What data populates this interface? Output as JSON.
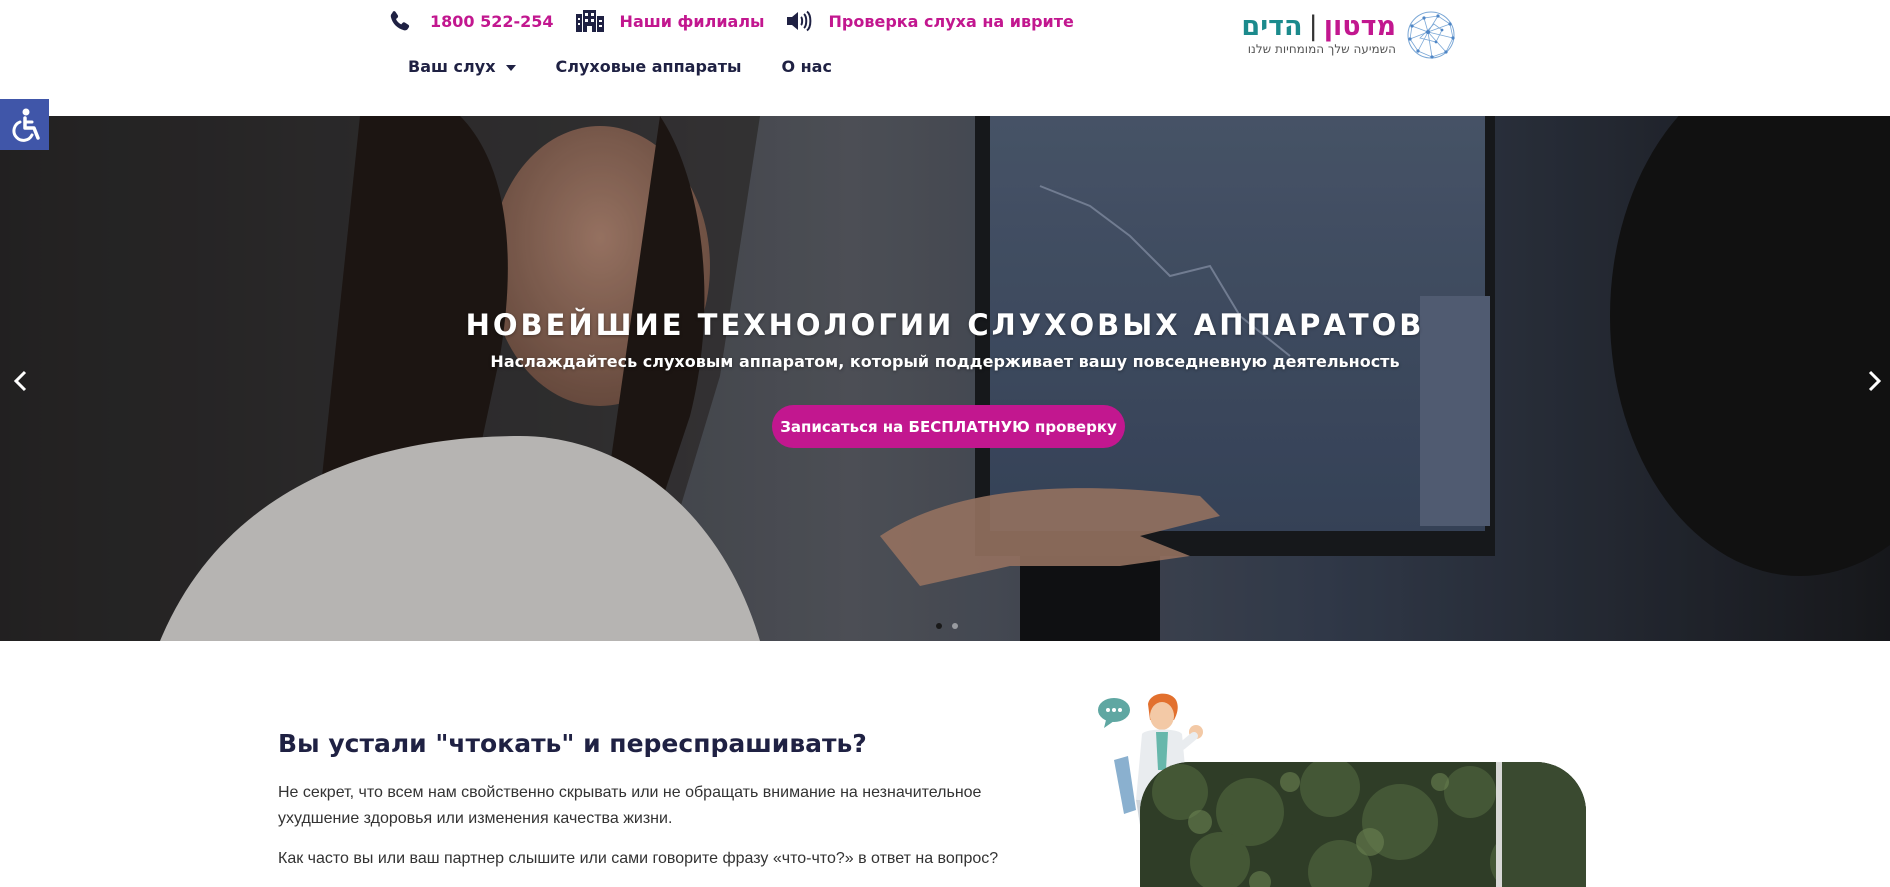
{
  "header": {
    "contacts": [
      {
        "icon": "phone-icon",
        "label": "1800 522-254"
      },
      {
        "icon": "building-icon",
        "label": "Наши филиалы"
      },
      {
        "icon": "speaker-icon",
        "label": "Проверка слуха на иврите"
      }
    ],
    "nav": [
      {
        "label": "Ваш слух",
        "has_dropdown": true
      },
      {
        "label": "Слуховые аппараты"
      },
      {
        "label": "О нас"
      }
    ],
    "logo": {
      "name_part1": "מדטון",
      "separator": "|",
      "name_part2": "הדים",
      "tagline": "השמיעה שלך המומחיות שלנו"
    }
  },
  "accessibility": {
    "icon": "accessibility-icon"
  },
  "hero": {
    "title": "НОВЕЙШИЕ ТЕХНОЛОГИИ СЛУХОВЫХ АППАРАТОВ",
    "subtitle": "Наслаждайтесь слуховым аппаратом, который поддерживает вашу повседневную деятельность",
    "cta_label": "Записаться на БЕСПЛАТНУЮ проверку",
    "slides_total": 2,
    "active_slide": 1
  },
  "content": {
    "title": "Вы устали \"чтокать\" и переспрашивать?",
    "paragraph1": "Не секрет, что всем нам свойственно скрывать или не обращать внимание на незначительное ухудшение здоровья или изменения качества жизни.",
    "paragraph2": "Как часто вы или ваш партнер слышите или сами говорите фразу «что-что?» в ответ на вопрос?"
  },
  "colors": {
    "accent": "#c2178f",
    "navy": "#1f2143",
    "teal": "#1b8a8c",
    "accessibility_bg": "#4056a9"
  }
}
